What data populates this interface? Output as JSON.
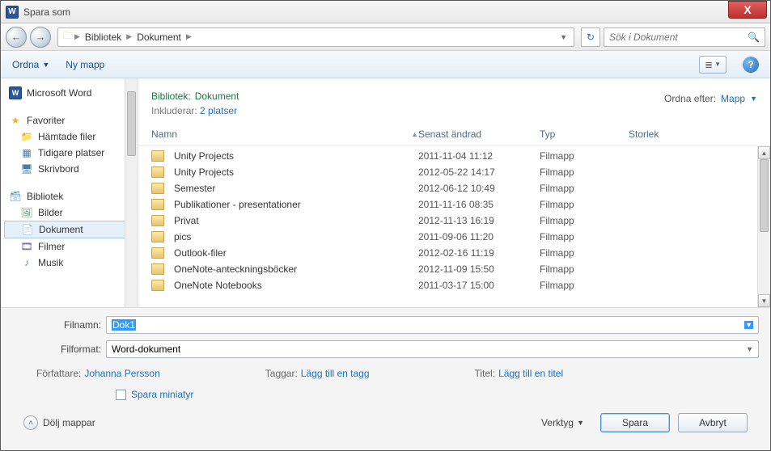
{
  "window": {
    "title": "Spara som",
    "close": "X"
  },
  "nav": {
    "back": "←",
    "fwd": "→",
    "crumbs": [
      "Bibliotek",
      "Dokument"
    ],
    "refresh": "↻",
    "search_placeholder": "Sök i Dokument"
  },
  "toolbar": {
    "organize": "Ordna",
    "newfolder": "Ny mapp",
    "help": "?"
  },
  "sidebar": {
    "word": "Microsoft Word",
    "fav_header": "Favoriter",
    "favs": [
      "Hämtade filer",
      "Tidigare platser",
      "Skrivbord"
    ],
    "lib_header": "Bibliotek",
    "libs": [
      "Bilder",
      "Dokument",
      "Filmer",
      "Musik"
    ]
  },
  "main": {
    "lib_prefix": "Bibliotek:",
    "lib_name": "Dokument",
    "includes_label": "Inkluderar:",
    "includes_link": "2 platser",
    "sort_label": "Ordna efter:",
    "sort_value": "Mapp",
    "cols": {
      "name": "Namn",
      "date": "Senast ändrad",
      "type": "Typ",
      "size": "Storlek"
    },
    "rows": [
      {
        "name": "Unity Projects",
        "date": "2011-11-04 11:12",
        "type": "Filmapp"
      },
      {
        "name": "Unity Projects",
        "date": "2012-05-22 14:17",
        "type": "Filmapp"
      },
      {
        "name": "Semester",
        "date": "2012-06-12 10:49",
        "type": "Filmapp"
      },
      {
        "name": "Publikationer - presentationer",
        "date": "2011-11-16 08:35",
        "type": "Filmapp"
      },
      {
        "name": "Privat",
        "date": "2012-11-13 16:19",
        "type": "Filmapp"
      },
      {
        "name": "pics",
        "date": "2011-09-06 11:20",
        "type": "Filmapp"
      },
      {
        "name": "Outlook-filer",
        "date": "2012-02-16 11:19",
        "type": "Filmapp"
      },
      {
        "name": "OneNote-anteckningsböcker",
        "date": "2012-11-09 15:50",
        "type": "Filmapp"
      },
      {
        "name": "OneNote Notebooks",
        "date": "2011-03-17 15:00",
        "type": "Filmapp"
      }
    ]
  },
  "fields": {
    "filename_label": "Filnamn:",
    "filename_value": "Dok1",
    "format_label": "Filformat:",
    "format_value": "Word-dokument"
  },
  "meta": {
    "author_label": "Författare:",
    "author_value": "Johanna Persson",
    "tags_label": "Taggar:",
    "tags_value": "Lägg till en tagg",
    "title_label": "Titel:",
    "title_value": "Lägg till en titel",
    "thumb_label": "Spara miniatyr"
  },
  "footer": {
    "hide": "Dölj mappar",
    "tools": "Verktyg",
    "save": "Spara",
    "cancel": "Avbryt"
  }
}
